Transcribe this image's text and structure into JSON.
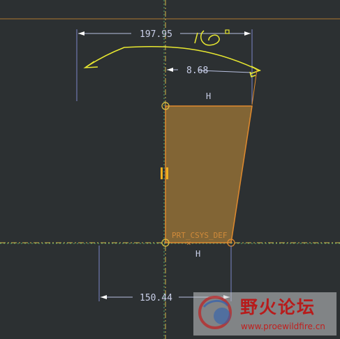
{
  "dimensions": {
    "top_width": "197.95",
    "offset": "8.68",
    "bottom_width": "150.44"
  },
  "constraints": {
    "top_horizontal": "H",
    "bottom_horizontal": "H"
  },
  "csys_label": "PRT_CSYS_DEF",
  "watermark": {
    "name": "野火论坛",
    "url": "www.proewildfire.cn"
  },
  "colors": {
    "background": "#2c3032",
    "fill": "#8a6a35",
    "sketch_edge": "#e08a2e",
    "dimension": "#c9cfe8",
    "annotation": "#e8e830",
    "centerline": "#d9b84a",
    "watermark_red": "#b81b1b"
  }
}
